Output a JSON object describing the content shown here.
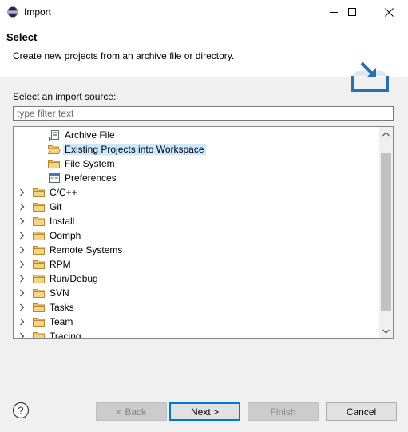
{
  "window": {
    "title": "Import"
  },
  "header": {
    "title": "Select",
    "description": "Create new projects from an archive file or directory."
  },
  "source": {
    "label": "Select an import source:",
    "filter_placeholder": "type filter text"
  },
  "tree": {
    "items": [
      {
        "label": "Archive File",
        "icon": "archive-file-icon",
        "level": 2,
        "selected": false
      },
      {
        "label": "Existing Projects into Workspace",
        "icon": "open-folder-icon",
        "level": 2,
        "selected": true
      },
      {
        "label": "File System",
        "icon": "folder-icon",
        "level": 2,
        "selected": false
      },
      {
        "label": "Preferences",
        "icon": "preferences-icon",
        "level": 2,
        "selected": false
      },
      {
        "label": "C/C++",
        "icon": "folder-icon",
        "level": 1,
        "selected": false
      },
      {
        "label": "Git",
        "icon": "folder-icon",
        "level": 1,
        "selected": false
      },
      {
        "label": "Install",
        "icon": "folder-icon",
        "level": 1,
        "selected": false
      },
      {
        "label": "Oomph",
        "icon": "folder-icon",
        "level": 1,
        "selected": false
      },
      {
        "label": "Remote Systems",
        "icon": "folder-icon",
        "level": 1,
        "selected": false
      },
      {
        "label": "RPM",
        "icon": "folder-icon",
        "level": 1,
        "selected": false
      },
      {
        "label": "Run/Debug",
        "icon": "folder-icon",
        "level": 1,
        "selected": false
      },
      {
        "label": "SVN",
        "icon": "folder-icon",
        "level": 1,
        "selected": false
      },
      {
        "label": "Tasks",
        "icon": "folder-icon",
        "level": 1,
        "selected": false
      },
      {
        "label": "Team",
        "icon": "folder-icon",
        "level": 1,
        "selected": false
      },
      {
        "label": "Tracing",
        "icon": "folder-icon",
        "level": 1,
        "selected": false
      }
    ]
  },
  "buttons": {
    "back": "< Back",
    "next": "Next >",
    "finish": "Finish",
    "cancel": "Cancel"
  },
  "colors": {
    "selection": "#cce8ff",
    "folder": "#dcb25a",
    "accent": "#0078d7"
  }
}
